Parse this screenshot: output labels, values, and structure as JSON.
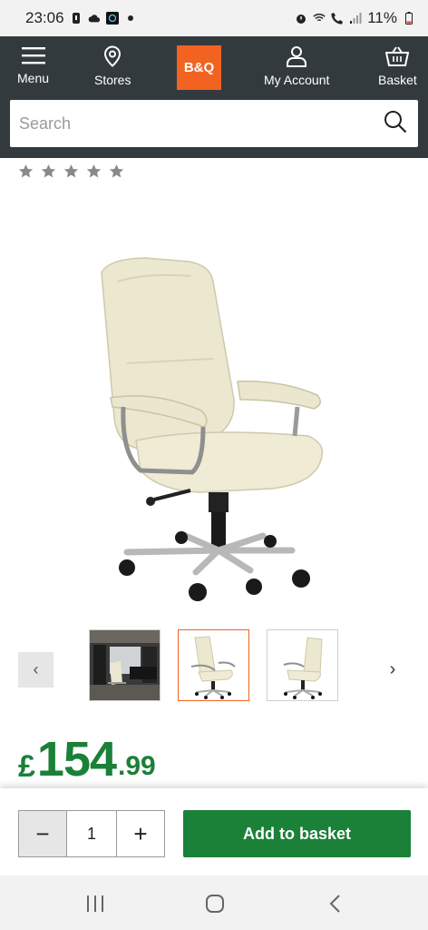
{
  "status_bar": {
    "time": "23:06",
    "battery": "11%"
  },
  "header": {
    "nav": {
      "menu_label": "Menu",
      "stores_label": "Stores",
      "account_label": "My Account",
      "basket_label": "Basket"
    },
    "logo_text": "B&Q",
    "search": {
      "placeholder": "Search"
    }
  },
  "product": {
    "rating_stars": 0,
    "rating_max": 5,
    "price": {
      "currency": "£",
      "main": "154",
      "decimal": ".99"
    }
  },
  "carousel": {
    "prev_icon": "chevron-left-icon",
    "next_icon": "chevron-right-icon",
    "prev_glyph": "‹",
    "next_glyph": "›",
    "selected_index": 1
  },
  "buy_bar": {
    "quantity": "1",
    "minus_glyph": "−",
    "plus_glyph": "+",
    "add_label": "Add to basket"
  },
  "colors": {
    "header_bg": "#333a3e",
    "brand_orange": "#f26322",
    "price_green": "#1b8038",
    "button_green": "#1b8038",
    "star_grey": "#8a8a8a"
  }
}
